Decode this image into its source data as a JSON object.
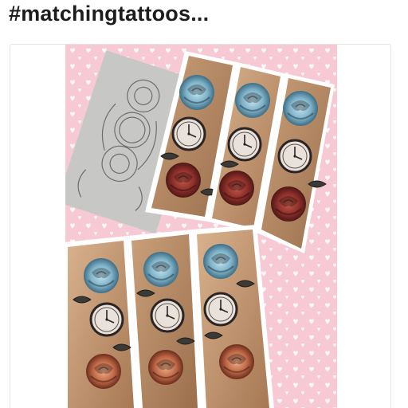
{
  "post": {
    "title": "#matchingtattoos..."
  },
  "colors": {
    "title_text": "#1c1c1c",
    "card_border": "#e4e4e4",
    "collage_background": "#f7c9d4",
    "heart_pattern": "#ffffff",
    "rose_red": "#8f2f2a",
    "rose_blue": "#7fb3c9",
    "skin_tone": "#c79a6e"
  },
  "media": {
    "type": "photo-collage",
    "panels": [
      {
        "content": "pencil-sketch"
      },
      {
        "content": "tattoo-photo"
      },
      {
        "content": "tattoo-photo"
      },
      {
        "content": "tattoo-photo"
      },
      {
        "content": "tattoo-photo"
      },
      {
        "content": "tattoo-photo"
      },
      {
        "content": "tattoo-photo"
      }
    ]
  }
}
